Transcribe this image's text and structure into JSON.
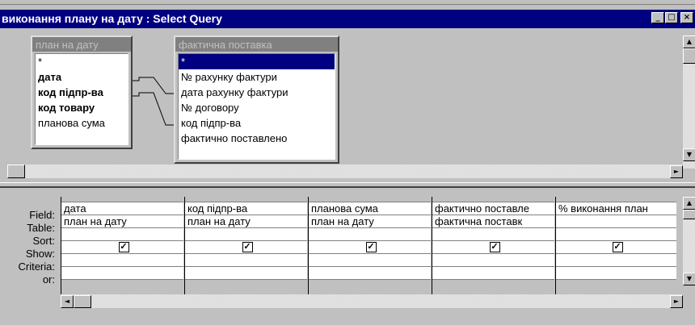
{
  "window": {
    "title": "виконання плану на дату : Select Query",
    "min_glyph": "_",
    "max_glyph": "□",
    "close_glyph": "×"
  },
  "tables": [
    {
      "title": "план на дату",
      "fields": [
        {
          "label": "*",
          "bold": false
        },
        {
          "label": "дата",
          "bold": true
        },
        {
          "label": "код підпр-ва",
          "bold": true
        },
        {
          "label": "код товару",
          "bold": true
        },
        {
          "label": "планова сума",
          "bold": false
        }
      ]
    },
    {
      "title": "фактична поставка",
      "fields": [
        {
          "label": "*",
          "bold": false
        },
        {
          "label": "№ рахунку фактури",
          "bold": false
        },
        {
          "label": "дата  рахунку фактури",
          "bold": false
        },
        {
          "label": "№ договору",
          "bold": false
        },
        {
          "label": "код підпр-ва",
          "bold": false
        },
        {
          "label": "фактично поставлено",
          "bold": false
        }
      ]
    }
  ],
  "grid": {
    "row_labels": [
      "Field:",
      "Table:",
      "Sort:",
      "Show:",
      "Criteria:",
      "or:"
    ],
    "columns": [
      {
        "field": "дата",
        "table": "план на дату",
        "show": true
      },
      {
        "field": "код підпр-ва",
        "table": "план на дату",
        "show": true
      },
      {
        "field": "планова сума",
        "table": "план на дату",
        "show": true
      },
      {
        "field": "фактично поставле",
        "table": "фактична поставк",
        "show": true
      },
      {
        "field": "% виконання план",
        "table": "",
        "show": true
      }
    ],
    "check_glyph": "✓"
  },
  "scroll": {
    "up": "▲",
    "down": "▼",
    "left": "◄",
    "right": "►"
  },
  "colors": {
    "titlebar": "#000080",
    "face": "#c0c0c0",
    "selection": "#000080"
  }
}
